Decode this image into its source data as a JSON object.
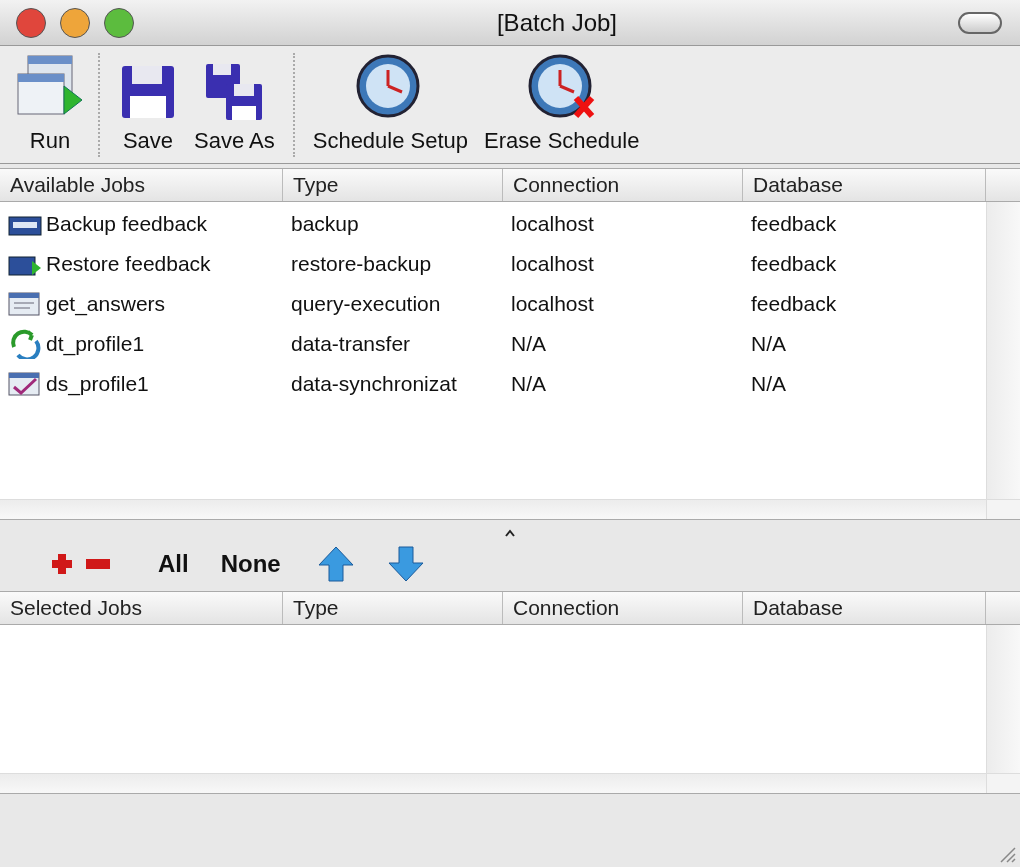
{
  "window": {
    "title": "[Batch Job]"
  },
  "toolbar": [
    {
      "label": "Run",
      "kind": "run"
    },
    {
      "label": "Save",
      "kind": "save"
    },
    {
      "label": "Save As",
      "kind": "saveas"
    },
    {
      "label": "Schedule Setup",
      "kind": "schedule"
    },
    {
      "label": "Erase Schedule",
      "kind": "erase"
    }
  ],
  "available_table": {
    "columns": [
      "Available Jobs",
      "Type",
      "Connection",
      "Database"
    ],
    "rows": [
      {
        "kind": "backup",
        "cells": [
          "Backup feedback",
          "backup",
          "localhost",
          "feedback"
        ]
      },
      {
        "kind": "restore",
        "cells": [
          "Restore feedback",
          "restore-backup",
          "localhost",
          "feedback"
        ]
      },
      {
        "kind": "query",
        "cells": [
          "get_answers",
          "query-execution",
          "localhost",
          "feedback"
        ]
      },
      {
        "kind": "transfer",
        "cells": [
          "dt_profile1",
          "data-transfer",
          "N/A",
          "N/A"
        ]
      },
      {
        "kind": "sync",
        "cells": [
          "ds_profile1",
          "data-synchronizat",
          "N/A",
          "N/A"
        ]
      }
    ]
  },
  "selection_bar": {
    "select_all": "All",
    "select_none": "None"
  },
  "selected_table": {
    "columns": [
      "Selected Jobs",
      "Type",
      "Connection",
      "Database"
    ]
  }
}
